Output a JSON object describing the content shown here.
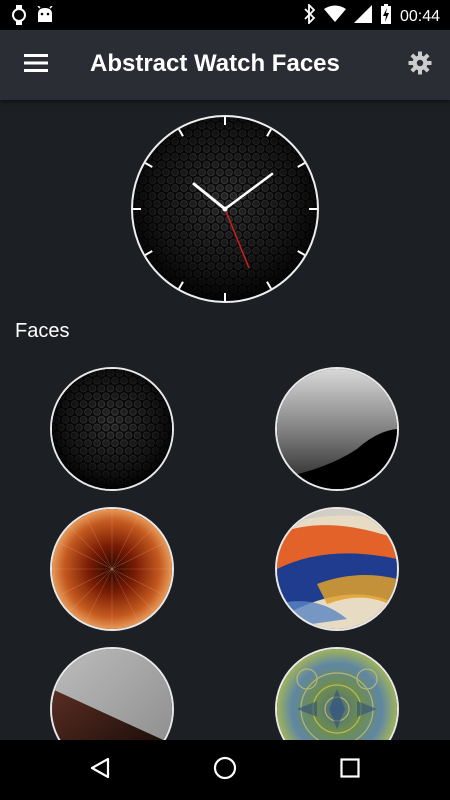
{
  "status_bar": {
    "time": "00:44",
    "icons": [
      "watch-icon",
      "android-icon",
      "bluetooth-icon",
      "wifi-icon",
      "signal-icon",
      "battery-charging-icon"
    ]
  },
  "app_bar": {
    "title": "Abstract Watch Faces",
    "menu_icon": "hamburger-menu-icon",
    "settings_icon": "gear-icon"
  },
  "preview": {
    "face": "honeycomb",
    "hour_hand_color": "#ffffff",
    "minute_hand_color": "#ffffff",
    "second_hand_color": "#cc1f1f"
  },
  "faces_section": {
    "heading": "Faces",
    "faces": [
      {
        "style": "honeycomb"
      },
      {
        "style": "glossy-black"
      },
      {
        "style": "radial-copper"
      },
      {
        "style": "watercolor"
      },
      {
        "style": "grey-diagonal"
      },
      {
        "style": "kaleidoscope"
      }
    ]
  },
  "nav_bar": {
    "icons": [
      "back-icon",
      "home-icon",
      "recents-icon"
    ]
  },
  "colors": {
    "background": "#1c1f24",
    "app_bar": "#2a2d33",
    "status_bar": "#000000"
  }
}
